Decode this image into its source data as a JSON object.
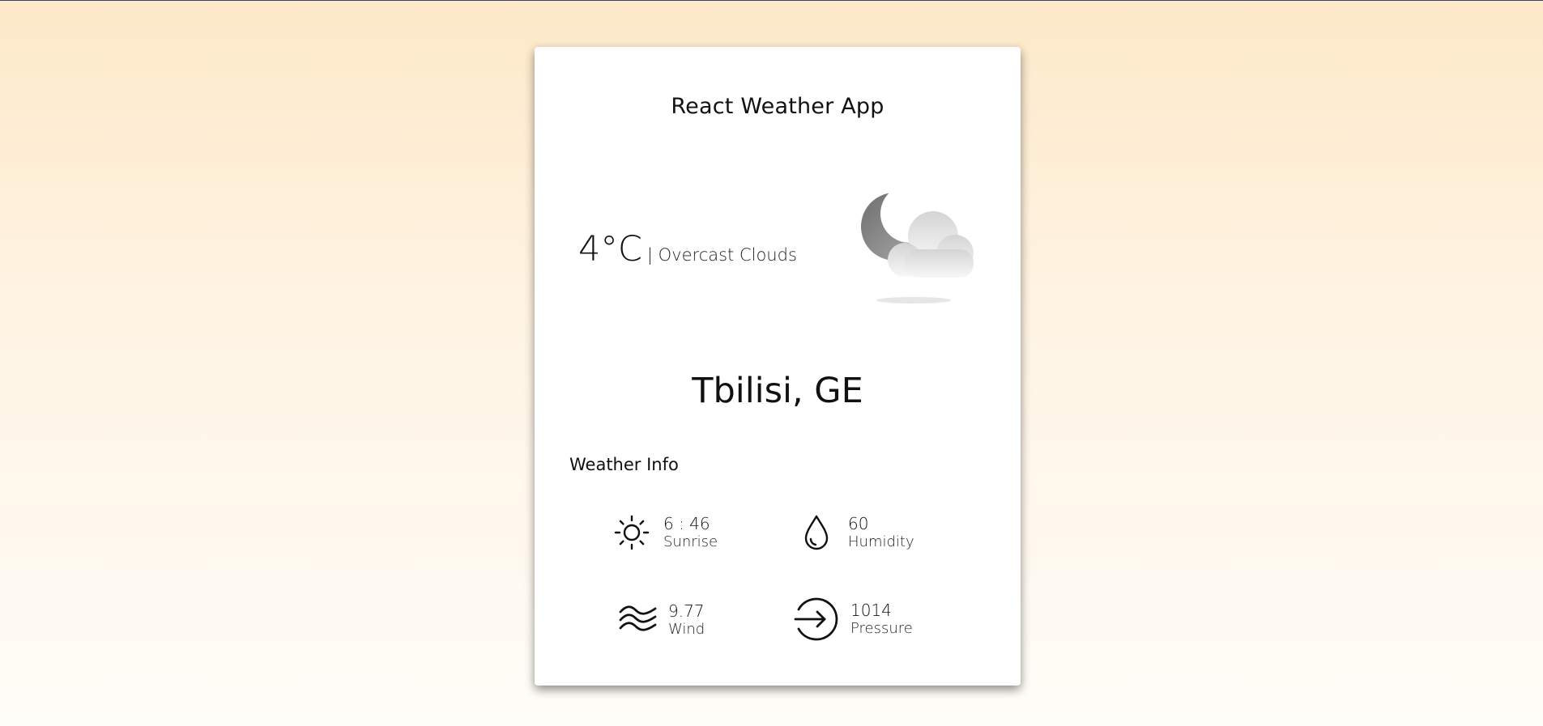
{
  "app": {
    "title": "React Weather App"
  },
  "current": {
    "temperature": "4°C",
    "description": "| Overcast Clouds",
    "icon": "moon-cloud-icon"
  },
  "location": {
    "city": "Tbilisi, GE"
  },
  "info": {
    "heading": "Weather Info",
    "items": [
      {
        "value": "6 : 46",
        "label": "Sunrise",
        "icon": "sun-icon"
      },
      {
        "value": "60",
        "label": "Humidity",
        "icon": "water-drop-icon"
      },
      {
        "value": "9.77",
        "label": "Wind",
        "icon": "wind-waves-icon"
      },
      {
        "value": "1014",
        "label": "Pressure",
        "icon": "arrow-circle-icon"
      }
    ]
  },
  "colors": {
    "background_top": "#fde9c9",
    "background_bottom": "#fffdf9",
    "card": "#ffffff",
    "text": "#111111"
  }
}
